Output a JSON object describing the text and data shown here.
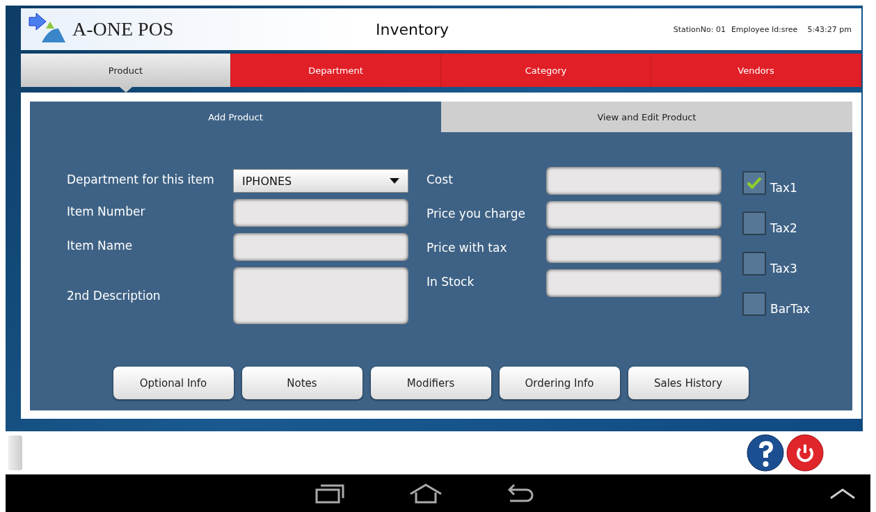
{
  "header": {
    "logo": "A-ONE POS",
    "title": "Inventory",
    "station": "StationNo: 01",
    "employee": "Employee Id:sree",
    "time": "5:43:27 pm"
  },
  "tabs": [
    {
      "label": "Product",
      "selected": true
    },
    {
      "label": "Department",
      "selected": false
    },
    {
      "label": "Category",
      "selected": false
    },
    {
      "label": "Vendors",
      "selected": false
    }
  ],
  "subtabs": [
    {
      "label": "Add Product",
      "selected": true
    },
    {
      "label": "View and Edit Product",
      "selected": false
    }
  ],
  "left_fields": [
    {
      "label": "Department for this item",
      "kind": "dropdown",
      "value": "IPHONES"
    },
    {
      "label": "Item Number",
      "kind": "text"
    },
    {
      "label": "Item Name",
      "kind": "text"
    },
    {
      "label": "2nd Description",
      "kind": "multiline"
    }
  ],
  "right_fields": [
    {
      "label": "Cost",
      "kind": "text"
    },
    {
      "label": "Price you charge",
      "kind": "text"
    },
    {
      "label": "Price with tax",
      "kind": "text"
    },
    {
      "label": "In Stock",
      "kind": "text"
    }
  ],
  "taxes": [
    {
      "label": "Tax1",
      "checked": true
    },
    {
      "label": "Tax2",
      "checked": false
    },
    {
      "label": "Tax3",
      "checked": false
    },
    {
      "label": "BarTax",
      "checked": false
    }
  ],
  "buttons": [
    "Optional Info",
    "Notes",
    "Modifiers",
    "Ordering Info",
    "Sales History"
  ]
}
